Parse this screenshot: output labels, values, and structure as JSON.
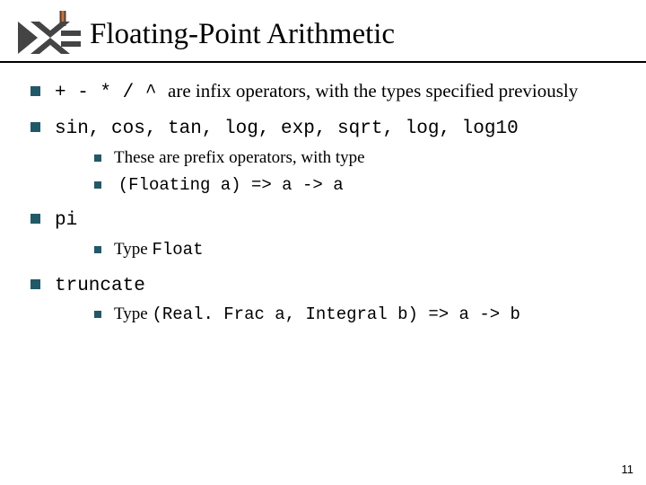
{
  "title": "Floating-Point Arithmetic",
  "page_number": "11",
  "bullets": {
    "b0": {
      "code_ops": "+ - * / ^ ",
      "tail": "are infix operators, with the types specified previously"
    },
    "b1": {
      "code_funcs": "sin, cos, tan, log, exp, sqrt, log, log10",
      "sub0": "These are prefix operators, with type",
      "sub1_code": "(Floating a) => a -> a"
    },
    "b2": {
      "code_word": "pi",
      "sub0_pre": "Type ",
      "sub0_code": "Float"
    },
    "b3": {
      "code_word": "truncate",
      "sub0_pre": "Type ",
      "sub0_code": "(Real. Frac a, Integral b) => a -> b"
    }
  }
}
